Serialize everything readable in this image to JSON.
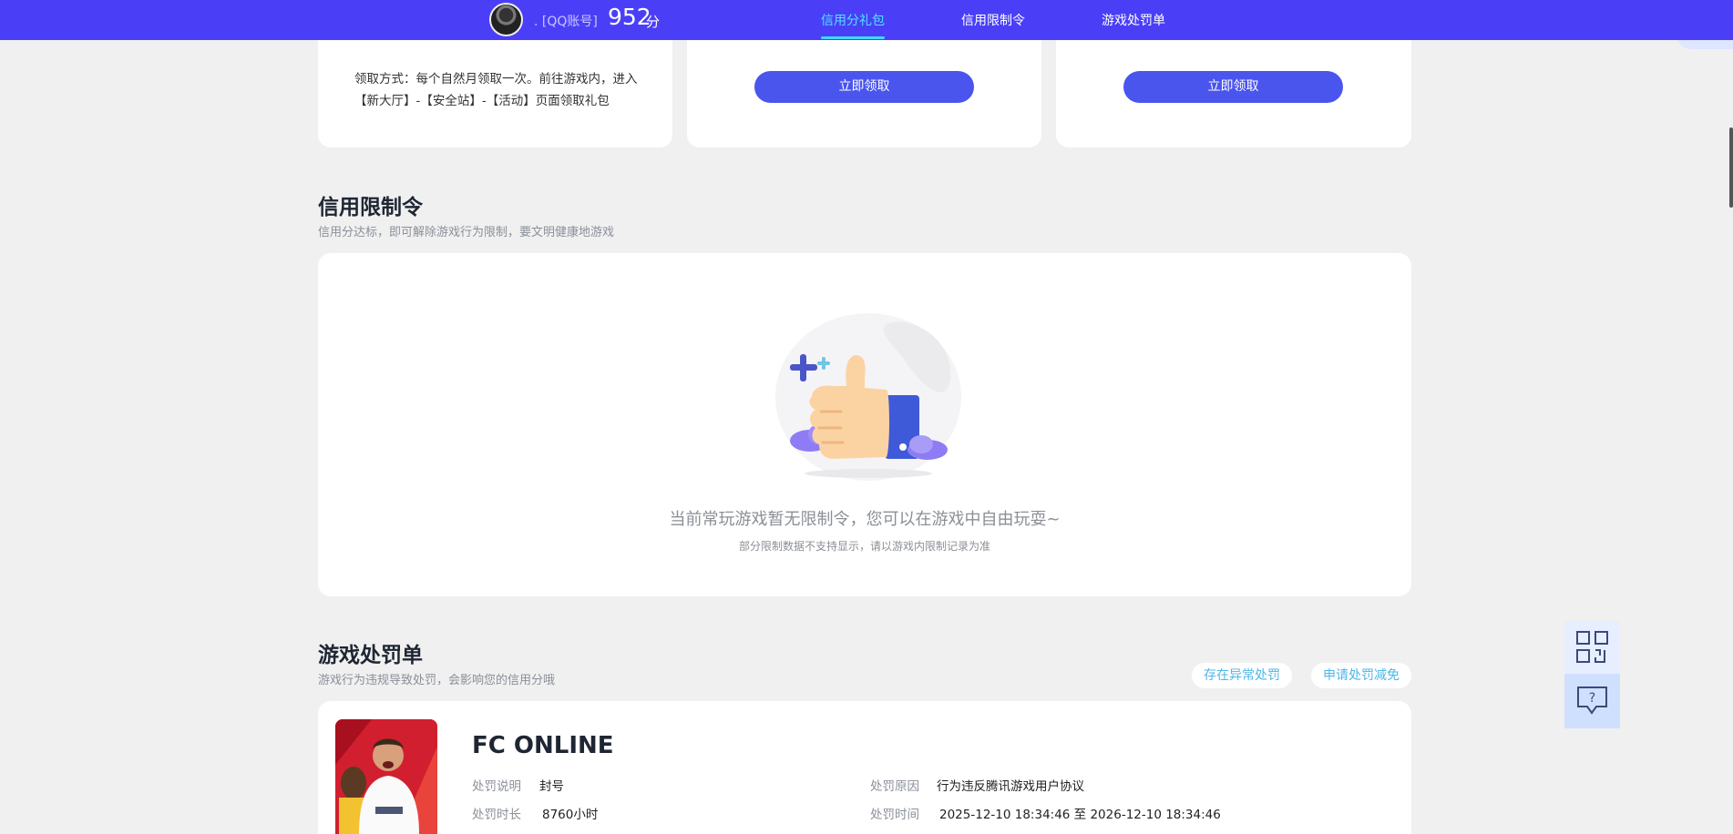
{
  "header": {
    "account_label": ". [QQ账号]",
    "score": "952",
    "score_unit": "分",
    "tabs": [
      {
        "label": "信用分礼包",
        "active": true
      },
      {
        "label": "信用限制令",
        "active": false
      },
      {
        "label": "游戏处罚单",
        "active": false
      }
    ]
  },
  "gift": {
    "method_text": "领取方式：每个自然月领取一次。前往游戏内，进入【新大厅】-【安全站】-【活动】页面领取礼包",
    "claim_label": "立即领取"
  },
  "restriction": {
    "title": "信用限制令",
    "subtitle": "信用分达标，即可解除游戏行为限制，要文明健康地游戏",
    "empty_main": "当前常玩游戏暂无限制令，您可以在游戏中自由玩耍~",
    "empty_sub": "部分限制数据不支持显示，请以游戏内限制记录为准"
  },
  "penalty": {
    "title": "游戏处罚单",
    "subtitle": "游戏行为违规导致处罚，会影响您的信用分哦",
    "abnormal_label": "存在异常处罚",
    "appeal_label": "申请处罚减免",
    "game": {
      "name": "FC ONLINE",
      "desc_label": "处罚说明",
      "desc_value": "封号",
      "reason_label": "处罚原因",
      "reason_value": "行为违反腾讯游戏用户协议",
      "duration_label": "处罚时长",
      "duration_value": "8760小时",
      "time_label": "处罚时间",
      "time_value": "2025-12-10 18:34:46 至 2026-12-10 18:34:46"
    }
  },
  "colors": {
    "topbar": "#4a3ff7",
    "active_tab": "#4fe4ff",
    "button": "#4a55ee",
    "link": "#4cb7e8"
  }
}
